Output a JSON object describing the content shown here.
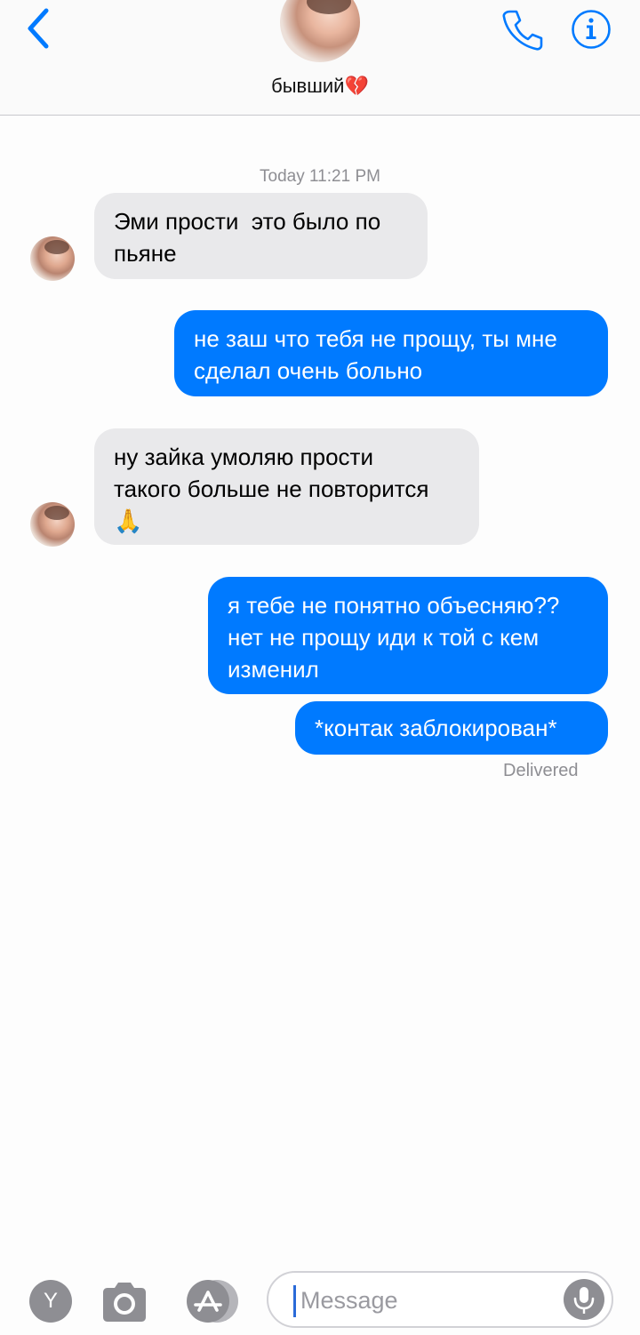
{
  "header": {
    "contact_name": "бывший💔",
    "back_icon": "chevron-left-icon",
    "call_icon": "phone-icon",
    "info_icon": "info-icon"
  },
  "conversation": {
    "timestamp": "Today 11:21 PM",
    "messages": [
      {
        "direction": "incoming",
        "text": "Эми прости  это было по\nпьяне"
      },
      {
        "direction": "outgoing",
        "text": "не заш что тебя не прощу, ты мне\nсделал очень больно"
      },
      {
        "direction": "incoming",
        "text": "ну зайка умоляю прости\nтакого больше не повторится\n🙏"
      },
      {
        "direction": "outgoing",
        "text": "я тебе не понятно объесняю??\nнет не прощу иди к той с кем\nизменил"
      },
      {
        "direction": "outgoing",
        "text": "*контак заблокирован*"
      }
    ],
    "status": "Delivered"
  },
  "composer": {
    "app_button_label": "Y",
    "placeholder": "Message",
    "camera_icon": "camera-icon",
    "appstore_icon": "app-store-icon",
    "mic_icon": "microphone-icon"
  },
  "colors": {
    "accent": "#007aff",
    "incoming_bubble": "#e9e9eb",
    "secondary_text": "#8e8e93"
  }
}
